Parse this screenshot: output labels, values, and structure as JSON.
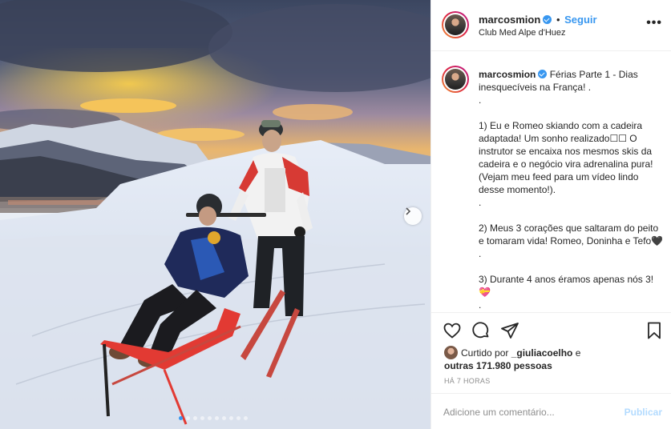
{
  "header": {
    "username": "marcosmion",
    "separator": "•",
    "follow_label": "Seguir",
    "location": "Club Med Alpe d'Huez",
    "more_label": "•••"
  },
  "caption": {
    "username": "marcosmion",
    "text": "Férias Parte 1 - Dias inesquecíveis na França! .\n.\n\n1) Eu e Romeo skiando com a cadeira adaptada! Um sonho realizado☐☐ O instrutor se encaixa nos mesmos skis da cadeira e o negócio vira adrenalina pura! (Vejam meu feed para um vídeo lindo desse momento!).\n.\n\n2) Meus 3 corações que saltaram do peito e tomaram vida! Romeo, Doninha e Tefo🖤\n.\n\n3) Durante 4 anos éramos apenas nós 3!💝\n."
  },
  "likes": {
    "prefix": "Curtido por ",
    "user": "_giuliacoelho",
    "middle": " e",
    "others": "outras 171.980 pessoas"
  },
  "time_ago": "HÁ 7 HORAS",
  "comment": {
    "placeholder": "Adicione um comentário...",
    "post_label": "Publicar"
  },
  "carousel": {
    "total": 10,
    "current": 1
  },
  "icons": {
    "like": "heart-icon",
    "comment": "comment-bubble-icon",
    "share": "paper-plane-icon",
    "save": "bookmark-icon",
    "next": "chevron-right-icon"
  },
  "colors": {
    "accent": "#3897f0",
    "verified": "#3897f0",
    "post_disabled": "#b3dbff"
  }
}
